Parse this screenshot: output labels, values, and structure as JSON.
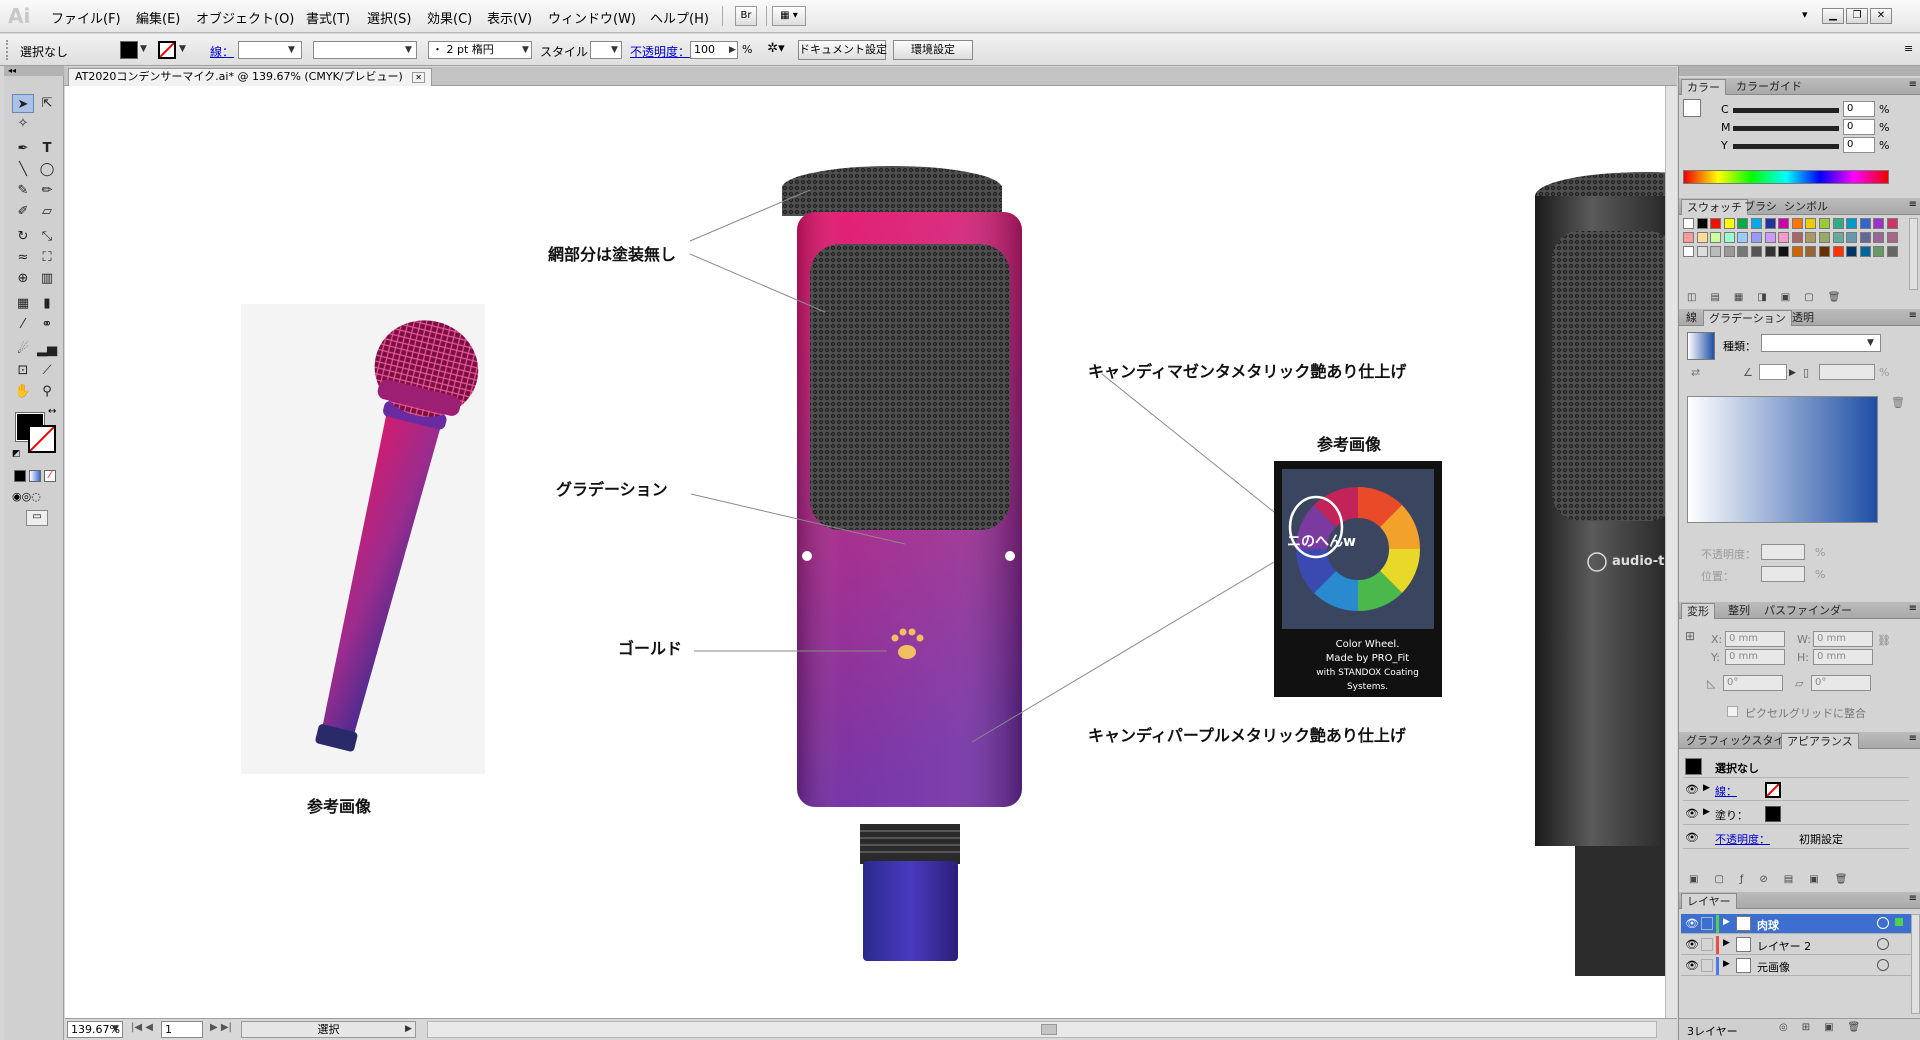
{
  "app": {
    "logo": "Ai"
  },
  "menu": [
    "ファイル(F)",
    "編集(E)",
    "オブジェクト(O)",
    "書式(T)",
    "選択(S)",
    "効果(C)",
    "表示(V)",
    "ウィンドウ(W)",
    "ヘルプ(H)"
  ],
  "menubar_icons": {
    "bridge": "Br",
    "arrange": "▦ ▾"
  },
  "window_controls": {
    "dropdown": "▾",
    "minimize": "▁",
    "restore": "❐",
    "close": "✕"
  },
  "control": {
    "selection": "選択なし",
    "stroke_label": "線：",
    "stroke_weight_value": "",
    "brush_value": "",
    "profile_value": "・ 2 pt 楕円",
    "style_label": "スタイル：",
    "opacity_label": "不透明度：",
    "opacity_value": "100",
    "opacity_unit": "%",
    "doc_settings": "ドキュメント設定",
    "prefs": "環境設定"
  },
  "document": {
    "tab_title": "AT2020コンデンサーマイク.ai* @ 139.67% (CMYK/プレビュー)",
    "close": "✕"
  },
  "annotations": {
    "mesh": "網部分は塗装無し",
    "magenta": "キャンディマゼンタメタリック艶あり仕上げ",
    "reference_right": "参考画像",
    "gradation": "グラデーション",
    "gold": "ゴールド",
    "purple": "キャンディパープルメタリック艶あり仕上げ",
    "reference_left": "参考画像"
  },
  "color_wheel_card": {
    "line1": "Color Wheel.",
    "line2": "Made by PRO_Fit",
    "line3": "with STANDOX Coating Systems.",
    "scribble": "ニのへんw"
  },
  "mic_brand": "audio-te",
  "status": {
    "zoom": "139.67%",
    "page": "1",
    "tool": "選択"
  },
  "panels": {
    "color": {
      "tab1": "カラー",
      "tab2": "カラーガイド",
      "channels": [
        {
          "label": "C",
          "value": "0",
          "unit": "%"
        },
        {
          "label": "M",
          "value": "0",
          "unit": "%"
        },
        {
          "label": "Y",
          "value": "0",
          "unit": "%"
        }
      ]
    },
    "swatches": {
      "tab1": "スウォッチ",
      "tab2": "ブラシ",
      "tab3": "シンボル"
    },
    "gradient": {
      "tab1": "線",
      "tab2": "グラデーション",
      "tab3": "透明",
      "type_label": "種類：",
      "type_value": "",
      "opacity_label": "不透明度：",
      "location_label": "位置：",
      "percent": "%"
    },
    "transform": {
      "tab1": "変形",
      "tab2": "整列",
      "tab3": "パスファインダー",
      "x_label": "X:",
      "x_value": "0 mm",
      "y_label": "Y:",
      "y_value": "0 mm",
      "w_label": "W:",
      "w_value": "0 mm",
      "h_label": "H:",
      "h_value": "0 mm",
      "rotate_value": "0°",
      "shear_value": "0°",
      "pixel_grid": "ピクセルグリッドに整合"
    },
    "appearance": {
      "tab1": "グラフィックスタイル",
      "tab2": "アピアランス",
      "title": "選択なし",
      "stroke": "線：",
      "fill": "塗り：",
      "opacity": "不透明度：",
      "opacity_value": "初期設定"
    },
    "layers": {
      "tab": "レイヤー",
      "count": "3レイヤー",
      "items": [
        {
          "name": "肉球",
          "color": "#4fd14f"
        },
        {
          "name": "レイヤー 2",
          "color": "#e84b4b"
        },
        {
          "name": "元画像",
          "color": "#4b7be8"
        }
      ]
    }
  },
  "colors": {
    "magenta": "#d6206f",
    "purple": "#4f2fa3",
    "gold": "#f0c060",
    "selection_blue": "#3d6fd1"
  }
}
